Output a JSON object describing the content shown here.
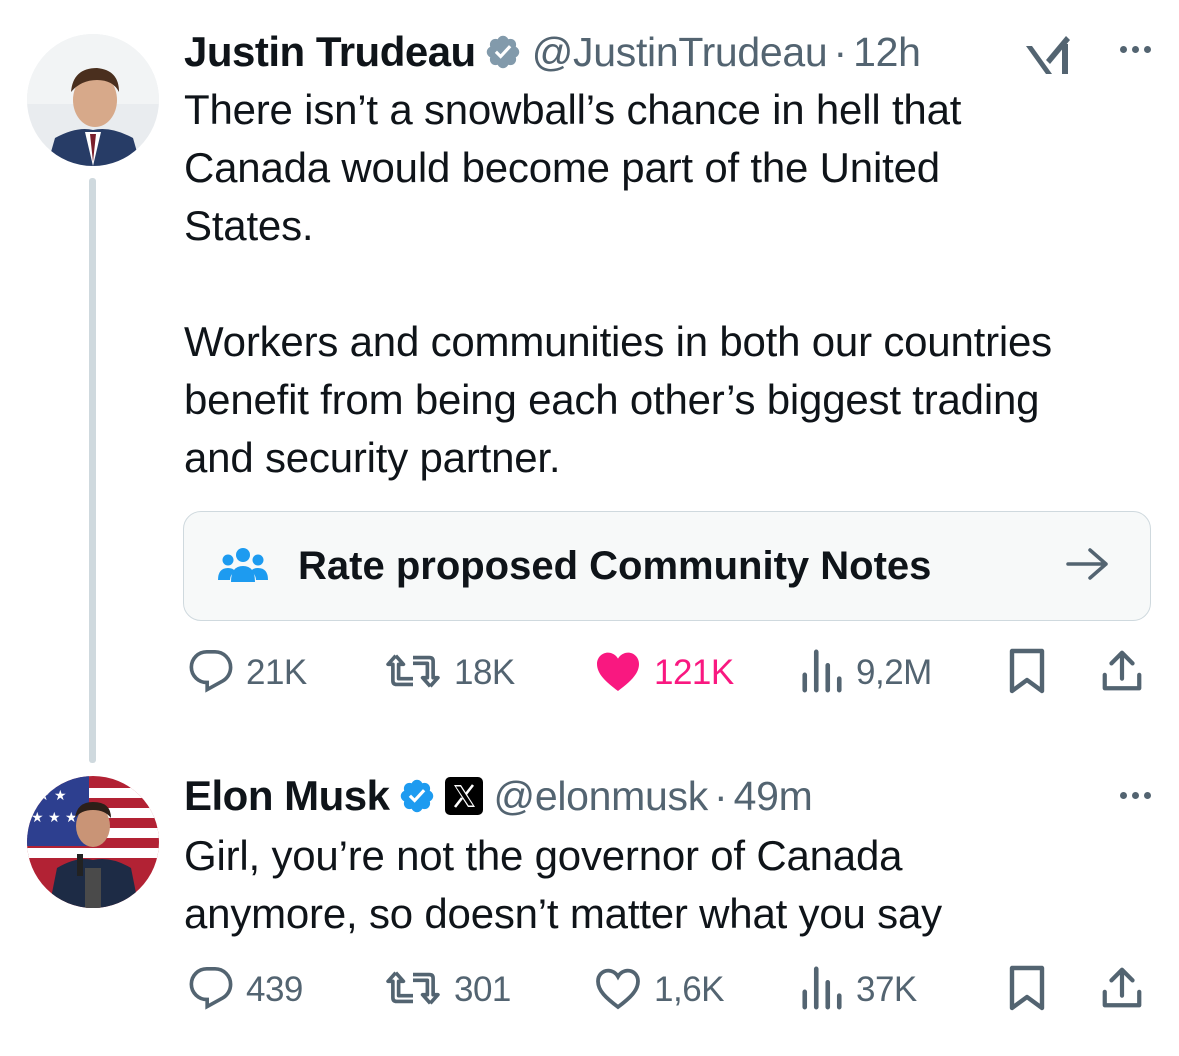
{
  "tweets": [
    {
      "author_name": "Justin Trudeau",
      "handle": "@JustinTrudeau",
      "separator": "·",
      "time": "12h",
      "text": "There isn’t a snowball’s chance in hell that\nCanada would become part of the United\nStates.\n\nWorkers and communities in both our countries\nbenefit from being each other’s biggest trading\nand security partner.",
      "community_notes_label": "Rate proposed Community Notes",
      "stats": {
        "replies": "21K",
        "reposts": "18K",
        "likes": "121K",
        "views": "9,2M"
      },
      "liked": true,
      "icons": [
        "verified-badge-icon",
        "grok-icon",
        "more-icon",
        "community-notes-icon",
        "arrow-right-icon",
        "reply-icon",
        "repost-icon",
        "heart-icon",
        "views-icon",
        "bookmark-icon",
        "share-icon"
      ]
    },
    {
      "author_name": "Elon Musk",
      "handle": "@elonmusk",
      "separator": "·",
      "time": "49m",
      "text": "Girl, you’re not the governor of Canada\nanymore, so doesn’t matter what you say",
      "stats": {
        "replies": "439",
        "reposts": "301",
        "likes": "1,6K",
        "views": "37K"
      },
      "liked": false,
      "icons": [
        "verified-badge-icon",
        "x-affiliate-icon",
        "more-icon",
        "reply-icon",
        "repost-icon",
        "heart-icon",
        "views-icon",
        "bookmark-icon",
        "share-icon"
      ]
    }
  ],
  "colors": {
    "text": "#0f1419",
    "secondary": "#536471",
    "verified": "#1d9bf0",
    "like": "#f91880",
    "border": "#cfd9de"
  }
}
